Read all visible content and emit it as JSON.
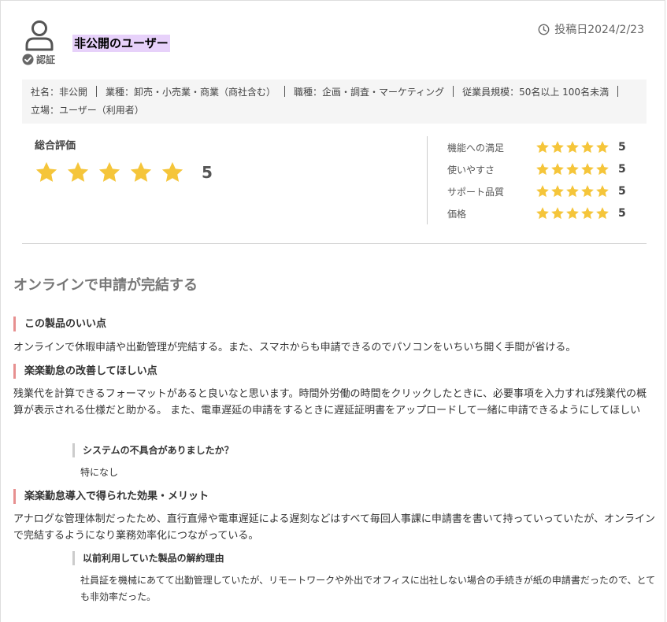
{
  "reviewer": {
    "name": "非公開のユーザー",
    "verified_label": "認証",
    "posted": "投稿日2024/2/23"
  },
  "company": {
    "name": "社名：非公開",
    "industry": "業種：卸売・小売業・商業（商社含む）",
    "job": "職種：企画・調査・マーケティング",
    "size": "従業員規模：50名以上 100名未満",
    "position": "立場：ユーザー（利用者）"
  },
  "rating": {
    "overall_label": "総合評価",
    "overall_score": 5,
    "overall_score_text": "5",
    "star_color": "#f5c53a",
    "items": [
      {
        "label": "機能への満足",
        "score": 5,
        "score_text": "5"
      },
      {
        "label": "使いやすさ",
        "score": 5,
        "score_text": "5"
      },
      {
        "label": "サポート品質",
        "score": 5,
        "score_text": "5"
      },
      {
        "label": "価格",
        "score": 5,
        "score_text": "5"
      }
    ]
  },
  "review": {
    "title": "オンラインで申請が完結する",
    "good_heading": "この製品のいい点",
    "good_text": "オンラインで休暇申請や出勤管理が完結する。また、スマホからも申請できるのでパソコンをいちいち開く手間が省ける。",
    "improve_heading": "楽楽勤怠の改善してほしい点",
    "improve_text": "残業代を計算できるフォーマットがあると良いなと思います。時間外労働の時間をクリックしたときに、必要事項を入力すれば残業代の概算が表示される仕様だと助かる。 また、電車遅延の申請をするときに遅延証明書をアップロードして一緒に申請できるようにしてほしい",
    "bug_heading": "システムの不具合がありましたか？",
    "bug_text": "特になし",
    "effect_heading": "楽楽勤怠導入で得られた効果・メリット",
    "effect_text": "アナログな管理体制だったため、直行直帰や電車遅延による遅刻などはすべて毎回人事課に申請書を書いて持っていっていたが、オンラインで完結するようになり業務効率化につながっている。",
    "prev_heading": "以前利用していた製品の解約理由",
    "prev_text": "社員証を機械にあてて出勤管理していたが、リモートワークや外出でオフィスに出社しない場合の手続きが紙の申請書だったので、とても非効率だった。"
  },
  "icons": {
    "avatar": "user-outline-icon",
    "verified": "check-circle-icon",
    "posted": "clock-icon",
    "star": "star-icon"
  }
}
